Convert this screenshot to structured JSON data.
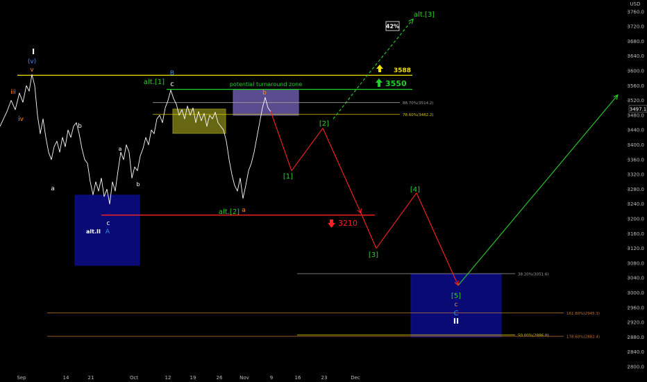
{
  "chart_data": {
    "type": "line",
    "currency": "USD",
    "last_price": "3497.1",
    "y_ticks": [
      "3760.0",
      "3720.0",
      "3680.0",
      "3640.0",
      "3600.0",
      "3560.0",
      "3520.0",
      "3480.0",
      "3440.0",
      "3400.0",
      "3360.0",
      "3320.0",
      "3280.0",
      "3240.0",
      "3200.0",
      "3160.0",
      "3120.0",
      "3080.0",
      "3040.0",
      "3000.0",
      "2960.0",
      "2920.0",
      "2880.0",
      "2840.0",
      "2800.0"
    ],
    "x_ticks": [
      "Sep",
      "14",
      "21",
      "Oct",
      "12",
      "19",
      "26",
      "Nov",
      "9",
      "16",
      "23",
      "Dec"
    ],
    "ylim": [
      2785,
      3785
    ],
    "price_series": [
      [
        0,
        3450
      ],
      [
        10,
        3490
      ],
      [
        16,
        3520
      ],
      [
        22,
        3495
      ],
      [
        28,
        3540
      ],
      [
        33,
        3515
      ],
      [
        38,
        3560
      ],
      [
        42,
        3545
      ],
      [
        46,
        3590
      ],
      [
        50,
        3560
      ],
      [
        54,
        3480
      ],
      [
        58,
        3430
      ],
      [
        62,
        3470
      ],
      [
        66,
        3420
      ],
      [
        70,
        3380
      ],
      [
        74,
        3360
      ],
      [
        78,
        3395
      ],
      [
        82,
        3410
      ],
      [
        86,
        3380
      ],
      [
        90,
        3420
      ],
      [
        94,
        3395
      ],
      [
        98,
        3440
      ],
      [
        102,
        3420
      ],
      [
        106,
        3450
      ],
      [
        110,
        3460
      ],
      [
        114,
        3430
      ],
      [
        118,
        3390
      ],
      [
        122,
        3360
      ],
      [
        126,
        3350
      ],
      [
        130,
        3300
      ],
      [
        134,
        3265
      ],
      [
        138,
        3300
      ],
      [
        142,
        3275
      ],
      [
        146,
        3310
      ],
      [
        150,
        3260
      ],
      [
        154,
        3280
      ],
      [
        158,
        3240
      ],
      [
        162,
        3300
      ],
      [
        166,
        3275
      ],
      [
        170,
        3330
      ],
      [
        174,
        3380
      ],
      [
        178,
        3360
      ],
      [
        182,
        3400
      ],
      [
        186,
        3380
      ],
      [
        190,
        3310
      ],
      [
        194,
        3340
      ],
      [
        198,
        3330
      ],
      [
        202,
        3370
      ],
      [
        206,
        3390
      ],
      [
        210,
        3420
      ],
      [
        214,
        3400
      ],
      [
        218,
        3440
      ],
      [
        222,
        3430
      ],
      [
        226,
        3470
      ],
      [
        230,
        3480
      ],
      [
        234,
        3460
      ],
      [
        238,
        3500
      ],
      [
        242,
        3520
      ],
      [
        246,
        3548
      ],
      [
        250,
        3525
      ],
      [
        254,
        3510
      ],
      [
        258,
        3480
      ],
      [
        262,
        3495
      ],
      [
        266,
        3470
      ],
      [
        270,
        3505
      ],
      [
        274,
        3480
      ],
      [
        278,
        3500
      ],
      [
        282,
        3460
      ],
      [
        286,
        3490
      ],
      [
        290,
        3465
      ],
      [
        294,
        3485
      ],
      [
        298,
        3450
      ],
      [
        302,
        3480
      ],
      [
        306,
        3470
      ],
      [
        310,
        3488
      ],
      [
        314,
        3460
      ],
      [
        318,
        3450
      ],
      [
        322,
        3440
      ],
      [
        326,
        3410
      ],
      [
        330,
        3360
      ],
      [
        334,
        3320
      ],
      [
        338,
        3290
      ],
      [
        342,
        3275
      ],
      [
        346,
        3310
      ],
      [
        350,
        3255
      ],
      [
        354,
        3290
      ],
      [
        358,
        3330
      ],
      [
        362,
        3350
      ],
      [
        366,
        3380
      ],
      [
        370,
        3420
      ],
      [
        374,
        3460
      ],
      [
        378,
        3500
      ],
      [
        382,
        3528
      ],
      [
        386,
        3500
      ],
      [
        390,
        3490
      ]
    ],
    "projection": [
      [
        390,
        3490
      ],
      [
        420,
        3330
      ],
      [
        465,
        3445
      ],
      [
        520,
        3215
      ],
      [
        542,
        3120
      ],
      [
        600,
        3270
      ],
      [
        660,
        3020
      ],
      [
        890,
        3535
      ]
    ],
    "alt_projection": [
      [
        480,
        3470
      ],
      [
        530,
        3590
      ],
      [
        595,
        3740
      ]
    ],
    "horizontal_lines": [
      {
        "label": "",
        "value": 3588,
        "color": "#f2e200"
      },
      {
        "label": "",
        "value": 3550,
        "color": "#22d02a"
      },
      {
        "label": "",
        "value": 3210,
        "color": "#ff2020"
      }
    ],
    "fib_levels": [
      {
        "label": "88.70%(3514.2)",
        "value": 3514.2,
        "color": "#9e9e9e"
      },
      {
        "label": "78.60%(3482.2)",
        "value": 3482.2,
        "color": "#d6c700"
      },
      {
        "label": "38.20%(3051.6)",
        "value": 3051.6,
        "color": "#9e9e9e"
      },
      {
        "label": "161.80%(2945.3)",
        "value": 2945.3,
        "color": "#c4742c"
      },
      {
        "label": "50.00%(2886.0)",
        "value": 2886.0,
        "color": "#d6c700"
      },
      {
        "label": "178.60%(2882.4)",
        "value": 2882.4,
        "color": "#c4742c"
      }
    ],
    "boxes": [
      {
        "name": "alt-ii-zone",
        "color": "#0c0c8c",
        "label": "alt.II"
      },
      {
        "name": "consolidation-zone",
        "color": "#8a8a1a",
        "label": ""
      },
      {
        "name": "potential-turnaround-zone",
        "color": "#6a5aa8",
        "label": "potential turnaround zone"
      },
      {
        "name": "target-zone",
        "color": "#0c0c8c",
        "label": ""
      }
    ],
    "wave_labels": [
      {
        "text": "I",
        "color": "#ffffff"
      },
      {
        "text": "(v)",
        "color": "#4a8cf0"
      },
      {
        "text": "v",
        "color": "#ff8c1a"
      },
      {
        "text": "iii",
        "color": "#ff8c1a"
      },
      {
        "text": "iv",
        "color": "#ff8c1a"
      },
      {
        "text": "a",
        "color": "#ffffff"
      },
      {
        "text": "b",
        "color": "#ffffff"
      },
      {
        "text": "c",
        "color": "#ffffff"
      },
      {
        "text": "A",
        "color": "#3a8fd8"
      },
      {
        "text": "a",
        "color": "#ffffff"
      },
      {
        "text": "b",
        "color": "#ffffff"
      },
      {
        "text": "alt.[1]",
        "color": "#2ad12a"
      },
      {
        "text": "B",
        "color": "#3a8fd8"
      },
      {
        "text": "c",
        "color": "#ffffff"
      },
      {
        "text": "b",
        "color": "#ff8c1a"
      },
      {
        "text": "alt.[2]",
        "color": "#2ad12a"
      },
      {
        "text": "a",
        "color": "#ff8c1a"
      },
      {
        "text": "[1]",
        "color": "#2ad12a"
      },
      {
        "text": "[2]",
        "color": "#2ad12a"
      },
      {
        "text": "[3]",
        "color": "#2ad12a"
      },
      {
        "text": "[4]",
        "color": "#2ad12a"
      },
      {
        "text": "[5]",
        "color": "#2ad12a"
      },
      {
        "text": "c",
        "color": "#ff8c1a"
      },
      {
        "text": "C",
        "color": "#3a8fd8"
      },
      {
        "text": "II",
        "color": "#ffffff"
      },
      {
        "text": "alt.[3]",
        "color": "#2ad12a"
      }
    ],
    "annotations": {
      "probability": "42%",
      "target_high": "3588",
      "target_mid": "3550",
      "target_low": "3210"
    }
  },
  "colors": {
    "background": "#000000",
    "price": "#ffffff",
    "projection": "#ff2020",
    "bullish": "#2ad12a"
  },
  "icons": {
    "arrow_up_yellow": "arrow-up-icon",
    "arrow_up_green": "arrow-up-icon",
    "arrow_down_red": "arrow-down-icon"
  }
}
